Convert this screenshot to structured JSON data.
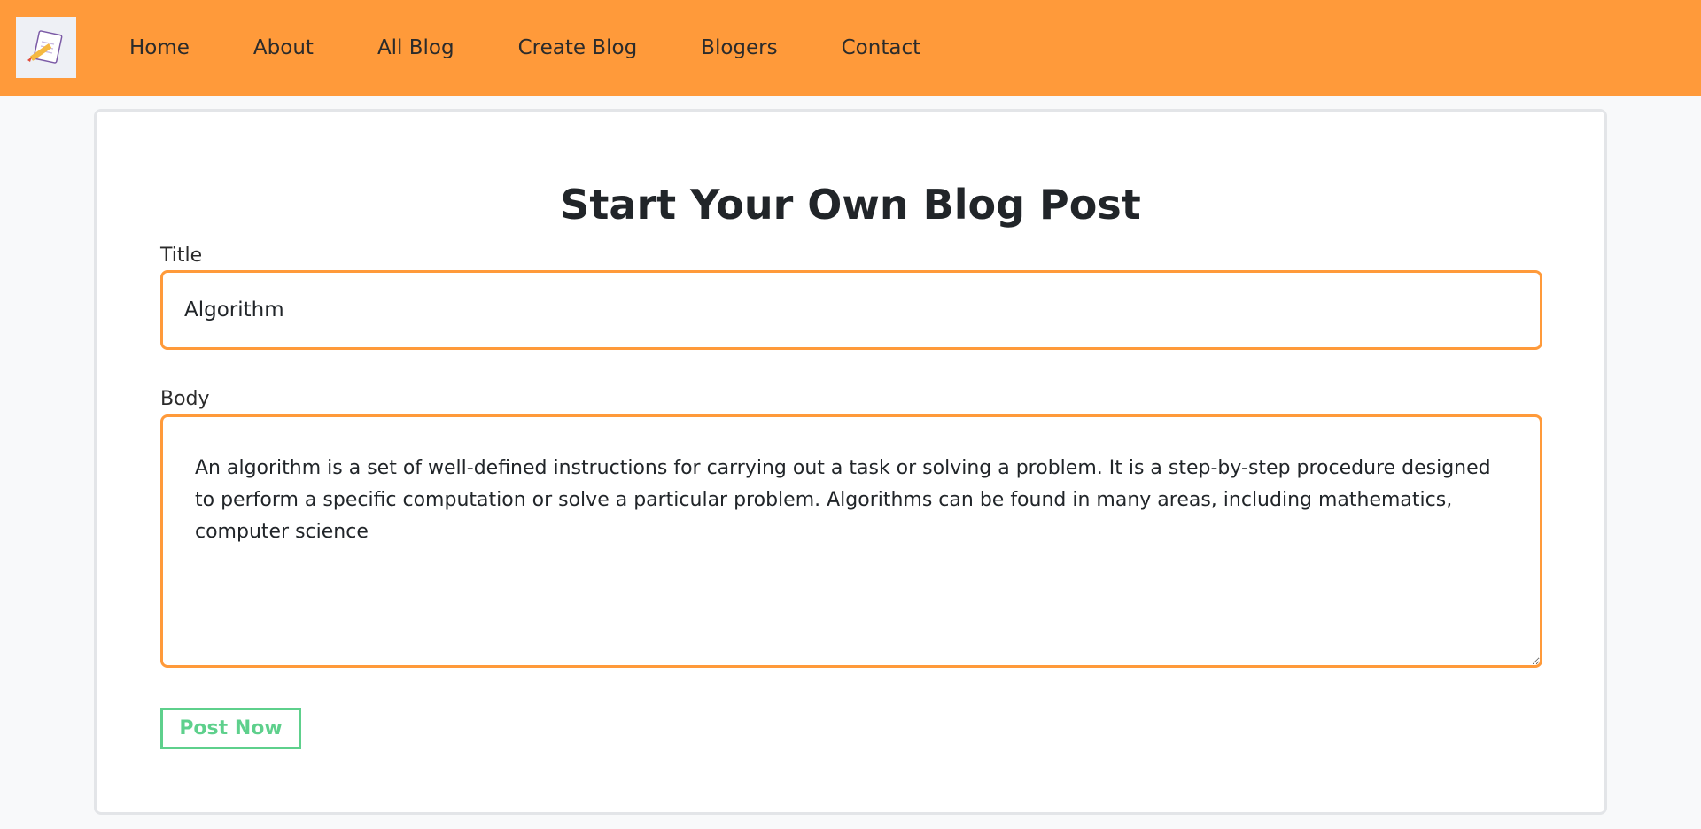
{
  "nav": {
    "logo_icon": "notepad-pencil-icon",
    "links": [
      "Home",
      "About",
      "All Blog",
      "Create Blog",
      "Blogers",
      "Contact"
    ]
  },
  "form": {
    "heading": "Start Your Own Blog Post",
    "title_label": "Title",
    "title_value": "Algorithm",
    "body_label": "Body",
    "body_value": "An algorithm is a set of well-defined instructions for carrying out a task or solving a problem. It is a step-by-step procedure designed to perform a specific computation or solve a particular problem. Algorithms can be found in many areas, including mathematics, computer science",
    "submit_label": "Post Now"
  },
  "colors": {
    "navbar": "#ff9a3a",
    "input_border": "#ff9a3a",
    "button_accent": "#5ed08c"
  }
}
